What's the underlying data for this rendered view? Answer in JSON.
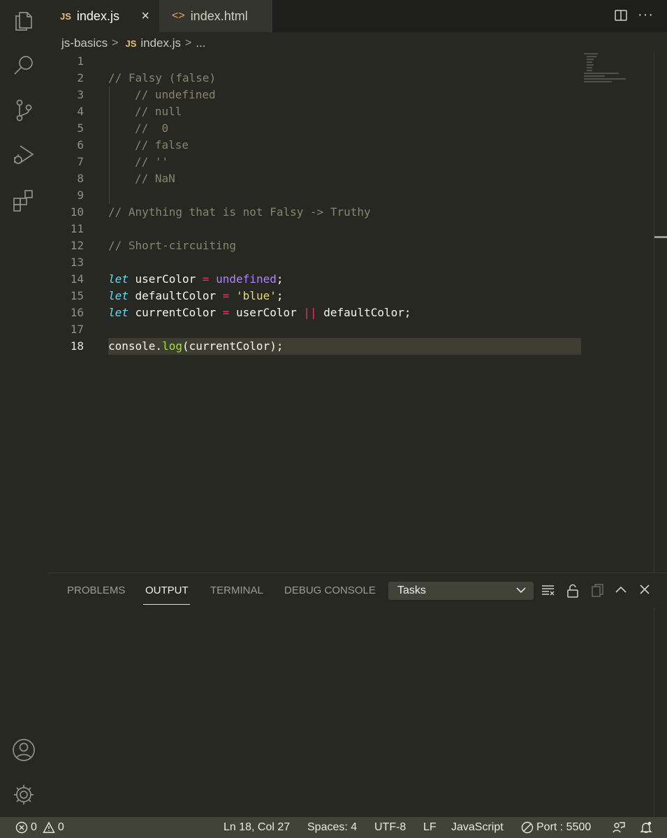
{
  "tabs": [
    {
      "badge": "JS",
      "label": "index.js",
      "close": "×"
    },
    {
      "badge": "<>",
      "label": "index.html"
    }
  ],
  "breadcrumb": {
    "folder": "js-basics",
    "sep": ">",
    "badge": "JS",
    "file": "index.js",
    "more": "..."
  },
  "editor": {
    "line_numbers": [
      "1",
      "2",
      "3",
      "4",
      "5",
      "6",
      "7",
      "8",
      "9",
      "10",
      "11",
      "12",
      "13",
      "14",
      "15",
      "16",
      "17",
      "18"
    ],
    "lines": {
      "l2": "// Falsy (false)",
      "l3": "// undefined",
      "l4": "// null",
      "l5": "//  0",
      "l6": "// false",
      "l7": "// ''",
      "l8": "// NaN",
      "l10": "// Anything that is not Falsy -> Truthy",
      "l12": "// Short-circuiting",
      "l14": {
        "kw": "let",
        "name": " userColor ",
        "op": "=",
        "val": " undefined",
        "end": ";"
      },
      "l15": {
        "kw": "let",
        "name": " defaultColor ",
        "op": "=",
        "val": " 'blue'",
        "end": ";"
      },
      "l16": {
        "kw": "let",
        "name": " currentColor ",
        "op": "=",
        "mid": " userColor ",
        "op2": "||",
        "end": " defaultColor;"
      },
      "l18": {
        "obj": "console.",
        "fn": "log",
        "end": "(currentColor);"
      }
    }
  },
  "panel": {
    "tabs": [
      "PROBLEMS",
      "OUTPUT",
      "TERMINAL",
      "DEBUG CONSOLE"
    ],
    "active_tab": "OUTPUT",
    "task_select": "Tasks"
  },
  "status": {
    "errors": "0",
    "warnings": "0",
    "position": "Ln 18, Col 27",
    "spaces": "Spaces: 4",
    "encoding": "UTF-8",
    "eol": "LF",
    "language": "JavaScript",
    "port": "Port : 5500"
  },
  "colors": {
    "bg": "#272822",
    "status_bg": "#414339",
    "keyword": "#66d9ef",
    "operator": "#f92672",
    "string": "#e6db74",
    "function": "#a6e22e",
    "constant": "#ae81ff",
    "comment": "#88846f"
  },
  "icons": [
    "files-icon",
    "search-icon",
    "source-control-icon",
    "run-debug-icon",
    "extensions-icon",
    "account-icon",
    "gear-icon",
    "split-editor-icon",
    "more-actions-icon",
    "clear-output-icon",
    "lock-icon",
    "copy-icon",
    "maximize-panel-icon",
    "close-panel-icon",
    "error-icon",
    "warning-icon",
    "port-icon",
    "feedback-icon",
    "bell-icon"
  ]
}
